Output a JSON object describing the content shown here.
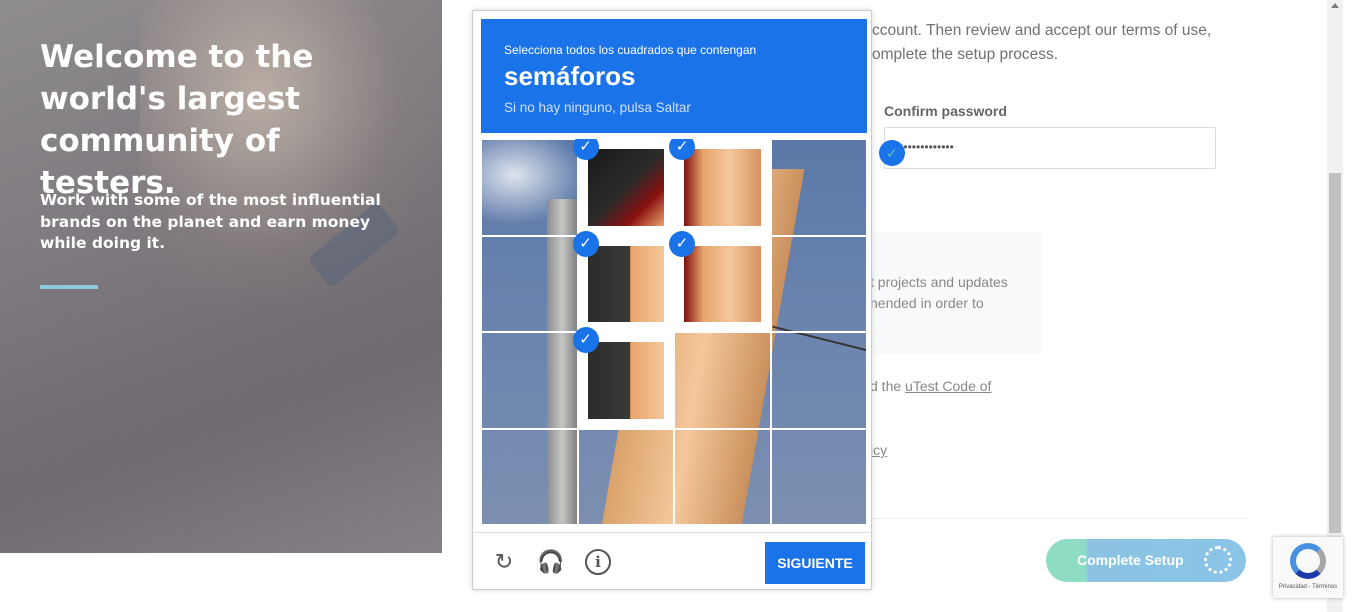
{
  "hero": {
    "title": "Welcome to the world's largest community of testers.",
    "subtitle": "Work with some of the most influential brands on the planet and earn money while doing it."
  },
  "form": {
    "intro_line1": "ccount. Then review and accept our terms of use,",
    "intro_line2": "omplete the setup process.",
    "confirm_password_label": "Confirm password",
    "confirm_password_value": "••••••••••••••",
    "info_line1": "t projects and updates",
    "info_line2": "nended in order to",
    "code_prefix": "d the ",
    "code_link": "uTest Code of",
    "policy_fragment": "icy",
    "complete_button": "Complete Setup"
  },
  "captcha": {
    "instruction": "Selecciona todos los cuadrados que contengan",
    "keyword": "semáforos",
    "hint": "Si no hay ninguno, pulsa Saltar",
    "next_button": "SIGUIENTE",
    "selected_tiles": [
      1,
      2,
      5,
      6,
      9
    ]
  },
  "badge": {
    "text": "Privacidad - Términos"
  },
  "colors": {
    "captcha_blue": "#1a73e8",
    "accent_line": "#8ec9e0",
    "button_green": "#8fdcc4",
    "button_blue": "#8ac4e6"
  }
}
